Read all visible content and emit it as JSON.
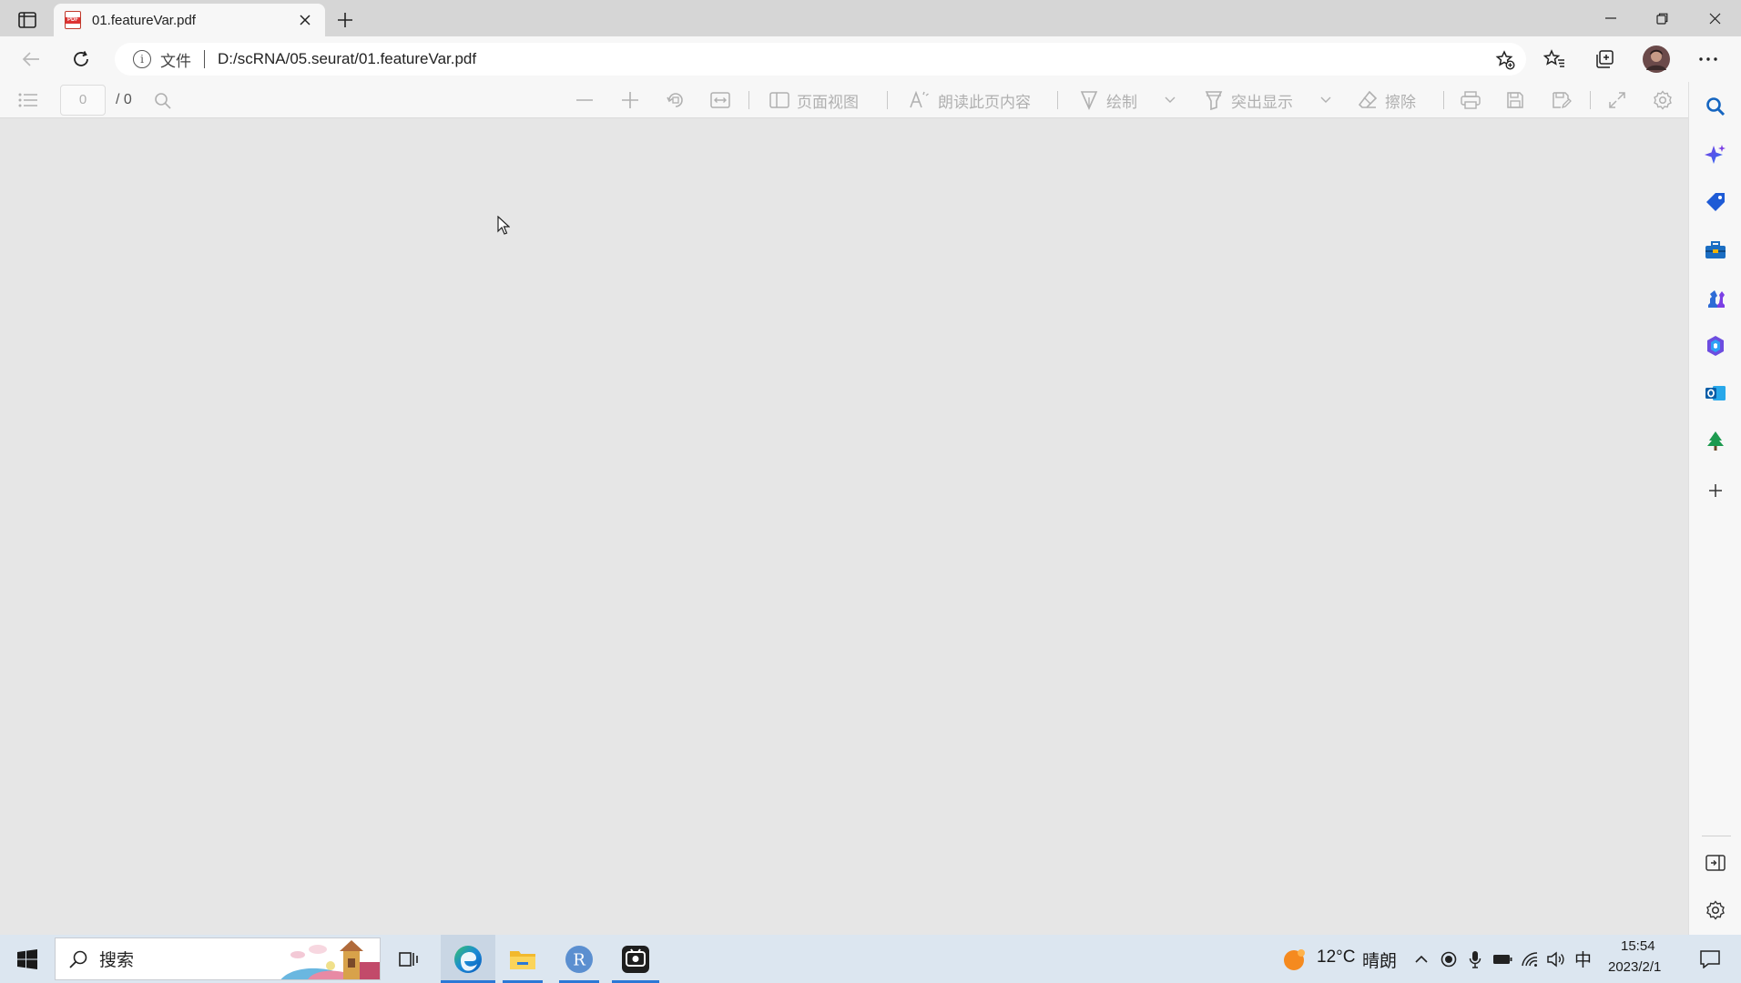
{
  "browser": {
    "tab": {
      "title": "01.featureVar.pdf"
    },
    "address": {
      "scheme_label": "文件",
      "url": "D:/scRNA/05.seurat/01.featureVar.pdf"
    }
  },
  "pdf_toolbar": {
    "page_input": "0",
    "page_total": "/ 0",
    "page_view_label": "页面视图",
    "read_aloud_label": "朗读此页内容",
    "draw_label": "绘制",
    "highlight_label": "突出显示",
    "erase_label": "擦除"
  },
  "taskbar": {
    "search_label": "搜索",
    "weather": {
      "temp": "12°C",
      "condition": "晴朗"
    },
    "ime": "中",
    "time": "15:54",
    "date": "2023/2/1"
  },
  "colors": {
    "accent": "#2b78d6",
    "toolbar_disabled": "#b0b0b0",
    "canvas_bg": "#e6e6e6"
  }
}
